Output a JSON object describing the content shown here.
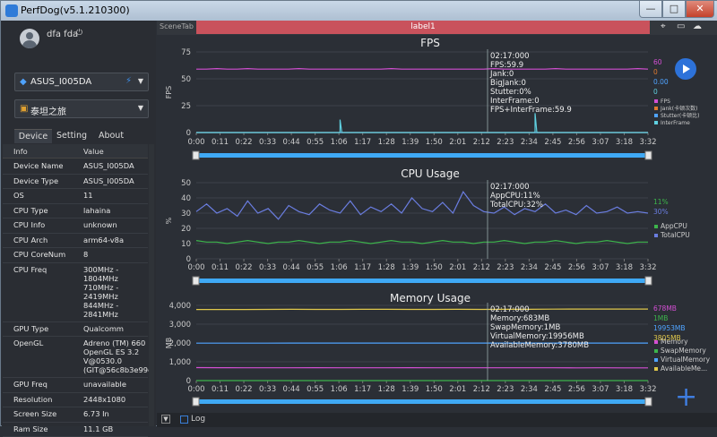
{
  "window": {
    "title": "PerfDog(v5.1.210300)",
    "min": "—",
    "max": "□",
    "close": "✕"
  },
  "sidebar": {
    "username": "dfa fda",
    "device_select": "ASUS_I005DA",
    "app_select": "泰坦之旅",
    "tabs": [
      "Device",
      "Setting",
      "About"
    ],
    "table_headers": [
      "Info",
      "Value"
    ],
    "rows": [
      {
        "k": "Device Name",
        "v": "ASUS_I005DA"
      },
      {
        "k": "Device Type",
        "v": "ASUS_I005DA"
      },
      {
        "k": "OS",
        "v": "11"
      },
      {
        "k": "CPU Type",
        "v": "lahaina"
      },
      {
        "k": "CPU Info",
        "v": "unknown"
      },
      {
        "k": "CPU Arch",
        "v": "arm64-v8a"
      },
      {
        "k": "CPU CoreNum",
        "v": "8"
      },
      {
        "k": "CPU Freq",
        "v": "300MHz -\n1804MHz\n710MHz -\n2419MHz\n844MHz -\n2841MHz"
      },
      {
        "k": "GPU Type",
        "v": "Qualcomm"
      },
      {
        "k": "OpenGL",
        "v": "Adreno (TM) 660\nOpenGL ES 3.2\nV@0530.0\n(GIT@56c8b3e99c"
      },
      {
        "k": "GPU Freq",
        "v": "unavailable"
      },
      {
        "k": "Resolution",
        "v": "2448x1080"
      },
      {
        "k": "Screen Size",
        "v": "6.73 In"
      },
      {
        "k": "Ram Size",
        "v": "11.1 GB"
      }
    ]
  },
  "topbar": {
    "scene_tab": "SceneTab",
    "label": "label1"
  },
  "bottombar": {
    "log_label": "Log"
  },
  "colors": {
    "accent": "#2d72d9",
    "label_bar": "#c9525c",
    "fps": "#d34fd3",
    "jank": "#e07a2e",
    "stutter": "#4fa3ff",
    "interframe": "#5fd0e0",
    "appcpu": "#3cb44b",
    "totalcpu": "#6a7de0",
    "memory": "#d34fd3",
    "swap": "#3cb44b",
    "virtual": "#4fa3ff",
    "available": "#e0c84b"
  },
  "chart_data": [
    {
      "type": "line",
      "title": "FPS",
      "ylabel": "FPS",
      "xticks": [
        "0:00",
        "0:11",
        "0:22",
        "0:33",
        "0:44",
        "0:55",
        "1:06",
        "1:17",
        "1:28",
        "1:39",
        "1:50",
        "2:01",
        "2:12",
        "2:23",
        "2:34",
        "2:45",
        "2:56",
        "3:07",
        "3:18",
        "3:32"
      ],
      "yticks": [
        0,
        25,
        50,
        75
      ],
      "ylim": [
        0,
        75
      ],
      "series": [
        {
          "name": "FPS",
          "values": [
            59,
            59,
            59.5,
            59,
            59,
            59.5,
            59,
            59,
            59,
            59,
            59.5,
            59,
            59,
            59,
            59,
            59,
            59,
            59,
            59,
            59.5,
            59,
            59,
            59,
            59,
            59,
            59,
            59,
            59,
            59,
            59.5,
            59,
            59,
            59,
            59,
            59,
            59.5,
            59,
            59,
            59,
            59,
            59,
            59,
            59,
            59.5,
            59
          ]
        },
        {
          "name": "Jank(卡顿次数)",
          "values": [
            0,
            0,
            0,
            0,
            0,
            0,
            0,
            0,
            0,
            0,
            0,
            0,
            0,
            0,
            0,
            0,
            0,
            0,
            0,
            0,
            0,
            0,
            0,
            0,
            0,
            0,
            0,
            0,
            0,
            0,
            0,
            0,
            0,
            0,
            0,
            0,
            0,
            0,
            0,
            0,
            0,
            0,
            0,
            0,
            0
          ]
        },
        {
          "name": "Stutter(卡顿比)",
          "values": [
            0,
            0,
            0,
            0,
            0,
            0,
            0,
            0,
            0,
            0,
            0,
            0,
            0,
            0,
            0,
            0,
            0,
            0,
            0,
            0,
            0,
            0,
            0,
            0,
            0,
            0,
            0,
            0,
            0,
            0,
            0,
            0,
            0,
            0,
            0,
            0,
            0,
            0,
            0,
            0,
            0,
            0,
            0,
            0,
            0
          ]
        },
        {
          "name": "InterFrame",
          "values": [
            0,
            0,
            0,
            0,
            0,
            0,
            0,
            0,
            0,
            0,
            0,
            0,
            0,
            0,
            0,
            0,
            0,
            0,
            0,
            0,
            0,
            0,
            0,
            0,
            0,
            0,
            0,
            0,
            0,
            0,
            0,
            0,
            0,
            0,
            0,
            0,
            0,
            0,
            0,
            0,
            0,
            0,
            0,
            0,
            0
          ]
        }
      ],
      "spikes": [
        {
          "x_index": 14,
          "value": 12
        },
        {
          "x_index": 33,
          "value": 18
        }
      ],
      "right_values": [
        "60",
        "0",
        "0.00",
        "0"
      ],
      "tooltip": [
        "02:17:000",
        "FPS:59.9",
        "Jank:0",
        "BigJank:0",
        "Stutter:0%",
        "InterFrame:0",
        "FPS+InterFrame:59.9"
      ]
    },
    {
      "type": "line",
      "title": "CPU Usage",
      "ylabel": "%",
      "xticks": [
        "0:00",
        "0:11",
        "0:22",
        "0:33",
        "0:44",
        "0:55",
        "1:06",
        "1:17",
        "1:28",
        "1:39",
        "1:50",
        "2:01",
        "2:12",
        "2:23",
        "2:34",
        "2:45",
        "2:56",
        "3:07",
        "3:18",
        "3:32"
      ],
      "yticks": [
        0,
        10,
        20,
        30,
        40,
        50
      ],
      "ylim": [
        0,
        50
      ],
      "series": [
        {
          "name": "AppCPU",
          "values": [
            12,
            11,
            11,
            10,
            11,
            12,
            11,
            10,
            11,
            11,
            12,
            11,
            10,
            11,
            11,
            12,
            11,
            10,
            11,
            12,
            11,
            11,
            10,
            11,
            12,
            11,
            11,
            10,
            11,
            11,
            12,
            11,
            10,
            11,
            11,
            12,
            11,
            10,
            11,
            11,
            12,
            11,
            10,
            11,
            11
          ]
        },
        {
          "name": "TotalCPU",
          "values": [
            31,
            36,
            30,
            33,
            28,
            38,
            30,
            33,
            26,
            35,
            31,
            29,
            36,
            32,
            30,
            38,
            29,
            34,
            31,
            36,
            30,
            40,
            33,
            31,
            37,
            30,
            44,
            35,
            31,
            30,
            34,
            29,
            33,
            31,
            36,
            30,
            32,
            29,
            35,
            30,
            31,
            34,
            30,
            31,
            30
          ]
        }
      ],
      "right_values": [
        "11%",
        "30%"
      ],
      "tooltip": [
        "02:17:000",
        "AppCPU:11%",
        "TotalCPU:32%"
      ]
    },
    {
      "type": "line",
      "title": "Memory Usage",
      "ylabel": "MB",
      "xticks": [
        "0:00",
        "0:11",
        "0:22",
        "0:33",
        "0:44",
        "0:55",
        "1:06",
        "1:17",
        "1:28",
        "1:39",
        "1:50",
        "2:01",
        "2:12",
        "2:23",
        "2:34",
        "2:45",
        "2:56",
        "3:07",
        "3:18",
        "3:32"
      ],
      "yticks": [
        "0",
        "1,000",
        "2,000",
        "3,000",
        "4,000"
      ],
      "ylim": [
        0,
        4000
      ],
      "series": [
        {
          "name": "Memory",
          "values": [
            690,
            685,
            683,
            680,
            682,
            684,
            683,
            681,
            683,
            684,
            683,
            682,
            683,
            683,
            683,
            680,
            678,
            679,
            678,
            678
          ]
        },
        {
          "name": "SwapMemory",
          "values": [
            1,
            1,
            1,
            1,
            1,
            1,
            1,
            1,
            1,
            1,
            1,
            1,
            1,
            1,
            1,
            1,
            1,
            1,
            1,
            1
          ]
        },
        {
          "name": "VirtualMemory",
          "values": [
            1990,
            1990,
            1990,
            1992,
            1994,
            1995,
            1995,
            1995,
            1995,
            1995,
            1995,
            1995,
            1995,
            1995,
            1995,
            1995,
            1995,
            1995,
            1995,
            1995
          ]
        },
        {
          "name": "AvailableMe...",
          "values": [
            3780,
            3782,
            3780,
            3785,
            3790,
            3788,
            3785,
            3790,
            3792,
            3788,
            3785,
            3790,
            3785,
            3790,
            3792,
            3800,
            3805,
            3803,
            3805,
            3805
          ]
        }
      ],
      "right_values": [
        "678MB",
        "1MB",
        "19953MB",
        "3805MB"
      ],
      "tooltip": [
        "02:17:000",
        "Memory:683MB",
        "SwapMemory:1MB",
        "VirtualMemory:19956MB",
        "AvailableMemory:3780MB"
      ]
    }
  ]
}
